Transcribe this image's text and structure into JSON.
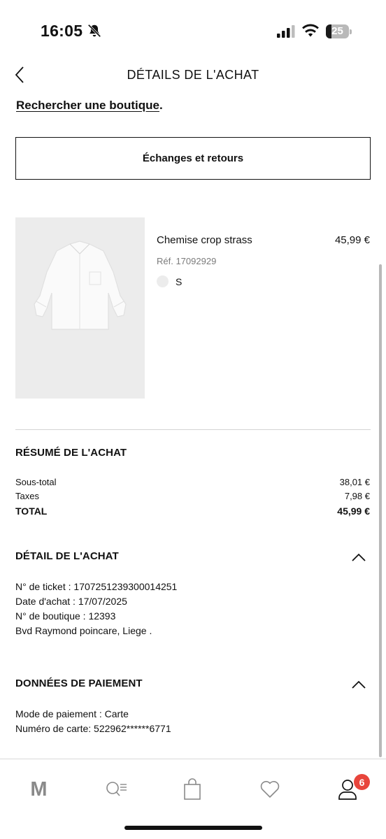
{
  "status_bar": {
    "time": "16:05",
    "battery_level": "25",
    "battery_fraction": 0.25
  },
  "header": {
    "title": "DÉTAILS DE L'ACHAT",
    "back_icon": "chevron-left-icon"
  },
  "store_link": {
    "label": "Rechercher une boutique",
    "suffix": "."
  },
  "exchange_button": {
    "label": "Échanges et retours"
  },
  "product": {
    "name": "Chemise crop strass",
    "price": "45,99 €",
    "reference": "Réf. 17092929",
    "size": "S",
    "color_swatch": "#ececec",
    "image_icon": "shirt-image"
  },
  "summary": {
    "title": "RÉSUMÉ DE L'ACHAT",
    "rows": [
      {
        "label": "Sous-total",
        "value": "38,01 €"
      },
      {
        "label": "Taxes",
        "value": "7,98 €"
      },
      {
        "label": "TOTAL",
        "value": "45,99 €"
      }
    ]
  },
  "purchase_detail": {
    "title": "DÉTAIL DE L'ACHAT",
    "lines": [
      "N° de ticket : 1707251239300014251",
      "Date d'achat : 17/07/2025",
      "N° de boutique : 12393",
      "Bvd Raymond poincare, Liege ."
    ]
  },
  "payment": {
    "title": "DONNÉES DE PAIEMENT",
    "lines": [
      "Mode de paiement : Carte",
      "Numéro de carte: 522962******6771"
    ]
  },
  "tab_bar": {
    "items": [
      {
        "icon": "home-logo-icon",
        "letter": "M"
      },
      {
        "icon": "search-menu-icon"
      },
      {
        "icon": "shopping-bag-icon"
      },
      {
        "icon": "heart-icon"
      },
      {
        "icon": "user-icon"
      }
    ],
    "badge_count": "6",
    "badge_color": "#e8453c"
  }
}
